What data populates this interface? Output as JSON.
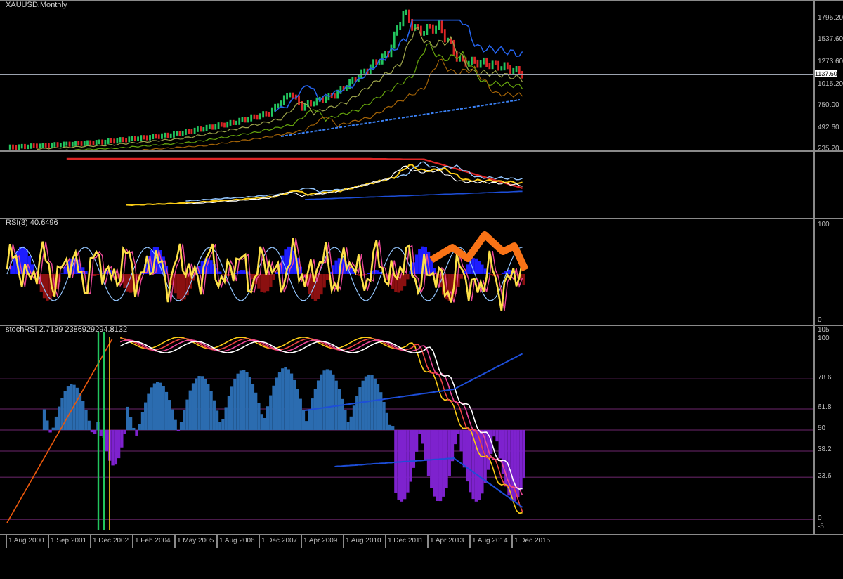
{
  "panels": [
    {
      "kind": "price",
      "title": "XAUUSD,Monthly",
      "axis_labels": [
        {
          "text": "1795.20",
          "highlighted": false
        },
        {
          "text": "1537.60",
          "highlighted": false
        },
        {
          "text": "1273.60",
          "highlighted": false
        },
        {
          "text": "1137.60",
          "highlighted": true
        },
        {
          "text": "1015.20",
          "highlighted": false
        },
        {
          "text": "750.00",
          "highlighted": false
        },
        {
          "text": "492.60",
          "highlighted": false
        },
        {
          "text": "235.20",
          "highlighted": false
        }
      ]
    },
    {
      "kind": "bands"
    },
    {
      "kind": "rsi",
      "title": "RSI(3) 40.6496",
      "axis_labels": [
        {
          "text": "100",
          "highlighted": false
        },
        {
          "text": "0",
          "highlighted": false
        }
      ]
    },
    {
      "kind": "stoch",
      "title": "stochRSI 2.7139 2386929294.8132",
      "axis_labels": [
        {
          "text": "105",
          "highlighted": false
        },
        {
          "text": "100",
          "highlighted": false
        },
        {
          "text": "78.6",
          "highlighted": false
        },
        {
          "text": "61.8",
          "highlighted": false
        },
        {
          "text": "50",
          "highlighted": false
        },
        {
          "text": "38.2",
          "highlighted": false
        },
        {
          "text": "23.6",
          "highlighted": false
        },
        {
          "text": "0",
          "highlighted": false
        },
        {
          "text": "-5",
          "highlighted": false
        }
      ]
    }
  ],
  "time_axis": [
    "1 Aug 2000",
    "1 Sep 2001",
    "1 Dec 2002",
    "1 Feb 2004",
    "1 May 2005",
    "1 Aug 2006",
    "1 Dec 2007",
    "1 Apr 2009",
    "1 Aug 2010",
    "1 Dec 2011",
    "1 Apr 2013",
    "1 Aug 2014",
    "1 Dec 2015"
  ]
}
